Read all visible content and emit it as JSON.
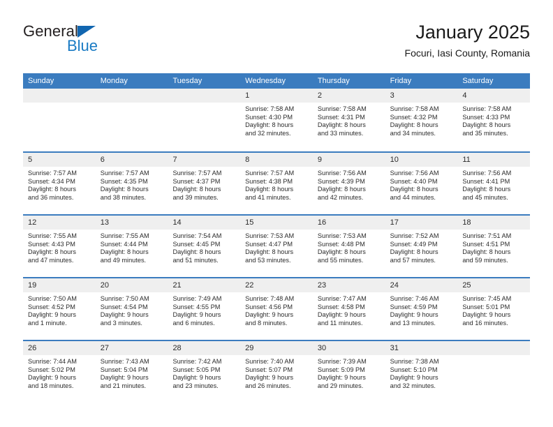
{
  "brand": {
    "line1": "General",
    "line2": "Blue",
    "triangle_color": "#1166b0",
    "blue_text_color": "#1a7bc4"
  },
  "header": {
    "title": "January 2025",
    "subtitle": "Focuri, Iasi County, Romania"
  },
  "theme": {
    "header_blue": "#3b7cbf",
    "daynum_band": "#efefef",
    "cell_bg": "#ffffff",
    "text": "#2b2b2b"
  },
  "weekdays": [
    "Sunday",
    "Monday",
    "Tuesday",
    "Wednesday",
    "Thursday",
    "Friday",
    "Saturday"
  ],
  "weeks": [
    [
      {
        "day": "",
        "sunrise": "",
        "sunset": "",
        "daylight_line1": "",
        "daylight_line2": ""
      },
      {
        "day": "",
        "sunrise": "",
        "sunset": "",
        "daylight_line1": "",
        "daylight_line2": ""
      },
      {
        "day": "",
        "sunrise": "",
        "sunset": "",
        "daylight_line1": "",
        "daylight_line2": ""
      },
      {
        "day": "1",
        "sunrise": "Sunrise: 7:58 AM",
        "sunset": "Sunset: 4:30 PM",
        "daylight_line1": "Daylight: 8 hours",
        "daylight_line2": "and 32 minutes."
      },
      {
        "day": "2",
        "sunrise": "Sunrise: 7:58 AM",
        "sunset": "Sunset: 4:31 PM",
        "daylight_line1": "Daylight: 8 hours",
        "daylight_line2": "and 33 minutes."
      },
      {
        "day": "3",
        "sunrise": "Sunrise: 7:58 AM",
        "sunset": "Sunset: 4:32 PM",
        "daylight_line1": "Daylight: 8 hours",
        "daylight_line2": "and 34 minutes."
      },
      {
        "day": "4",
        "sunrise": "Sunrise: 7:58 AM",
        "sunset": "Sunset: 4:33 PM",
        "daylight_line1": "Daylight: 8 hours",
        "daylight_line2": "and 35 minutes."
      }
    ],
    [
      {
        "day": "5",
        "sunrise": "Sunrise: 7:57 AM",
        "sunset": "Sunset: 4:34 PM",
        "daylight_line1": "Daylight: 8 hours",
        "daylight_line2": "and 36 minutes."
      },
      {
        "day": "6",
        "sunrise": "Sunrise: 7:57 AM",
        "sunset": "Sunset: 4:35 PM",
        "daylight_line1": "Daylight: 8 hours",
        "daylight_line2": "and 38 minutes."
      },
      {
        "day": "7",
        "sunrise": "Sunrise: 7:57 AM",
        "sunset": "Sunset: 4:37 PM",
        "daylight_line1": "Daylight: 8 hours",
        "daylight_line2": "and 39 minutes."
      },
      {
        "day": "8",
        "sunrise": "Sunrise: 7:57 AM",
        "sunset": "Sunset: 4:38 PM",
        "daylight_line1": "Daylight: 8 hours",
        "daylight_line2": "and 41 minutes."
      },
      {
        "day": "9",
        "sunrise": "Sunrise: 7:56 AM",
        "sunset": "Sunset: 4:39 PM",
        "daylight_line1": "Daylight: 8 hours",
        "daylight_line2": "and 42 minutes."
      },
      {
        "day": "10",
        "sunrise": "Sunrise: 7:56 AM",
        "sunset": "Sunset: 4:40 PM",
        "daylight_line1": "Daylight: 8 hours",
        "daylight_line2": "and 44 minutes."
      },
      {
        "day": "11",
        "sunrise": "Sunrise: 7:56 AM",
        "sunset": "Sunset: 4:41 PM",
        "daylight_line1": "Daylight: 8 hours",
        "daylight_line2": "and 45 minutes."
      }
    ],
    [
      {
        "day": "12",
        "sunrise": "Sunrise: 7:55 AM",
        "sunset": "Sunset: 4:43 PM",
        "daylight_line1": "Daylight: 8 hours",
        "daylight_line2": "and 47 minutes."
      },
      {
        "day": "13",
        "sunrise": "Sunrise: 7:55 AM",
        "sunset": "Sunset: 4:44 PM",
        "daylight_line1": "Daylight: 8 hours",
        "daylight_line2": "and 49 minutes."
      },
      {
        "day": "14",
        "sunrise": "Sunrise: 7:54 AM",
        "sunset": "Sunset: 4:45 PM",
        "daylight_line1": "Daylight: 8 hours",
        "daylight_line2": "and 51 minutes."
      },
      {
        "day": "15",
        "sunrise": "Sunrise: 7:53 AM",
        "sunset": "Sunset: 4:47 PM",
        "daylight_line1": "Daylight: 8 hours",
        "daylight_line2": "and 53 minutes."
      },
      {
        "day": "16",
        "sunrise": "Sunrise: 7:53 AM",
        "sunset": "Sunset: 4:48 PM",
        "daylight_line1": "Daylight: 8 hours",
        "daylight_line2": "and 55 minutes."
      },
      {
        "day": "17",
        "sunrise": "Sunrise: 7:52 AM",
        "sunset": "Sunset: 4:49 PM",
        "daylight_line1": "Daylight: 8 hours",
        "daylight_line2": "and 57 minutes."
      },
      {
        "day": "18",
        "sunrise": "Sunrise: 7:51 AM",
        "sunset": "Sunset: 4:51 PM",
        "daylight_line1": "Daylight: 8 hours",
        "daylight_line2": "and 59 minutes."
      }
    ],
    [
      {
        "day": "19",
        "sunrise": "Sunrise: 7:50 AM",
        "sunset": "Sunset: 4:52 PM",
        "daylight_line1": "Daylight: 9 hours",
        "daylight_line2": "and 1 minute."
      },
      {
        "day": "20",
        "sunrise": "Sunrise: 7:50 AM",
        "sunset": "Sunset: 4:54 PM",
        "daylight_line1": "Daylight: 9 hours",
        "daylight_line2": "and 3 minutes."
      },
      {
        "day": "21",
        "sunrise": "Sunrise: 7:49 AM",
        "sunset": "Sunset: 4:55 PM",
        "daylight_line1": "Daylight: 9 hours",
        "daylight_line2": "and 6 minutes."
      },
      {
        "day": "22",
        "sunrise": "Sunrise: 7:48 AM",
        "sunset": "Sunset: 4:56 PM",
        "daylight_line1": "Daylight: 9 hours",
        "daylight_line2": "and 8 minutes."
      },
      {
        "day": "23",
        "sunrise": "Sunrise: 7:47 AM",
        "sunset": "Sunset: 4:58 PM",
        "daylight_line1": "Daylight: 9 hours",
        "daylight_line2": "and 11 minutes."
      },
      {
        "day": "24",
        "sunrise": "Sunrise: 7:46 AM",
        "sunset": "Sunset: 4:59 PM",
        "daylight_line1": "Daylight: 9 hours",
        "daylight_line2": "and 13 minutes."
      },
      {
        "day": "25",
        "sunrise": "Sunrise: 7:45 AM",
        "sunset": "Sunset: 5:01 PM",
        "daylight_line1": "Daylight: 9 hours",
        "daylight_line2": "and 16 minutes."
      }
    ],
    [
      {
        "day": "26",
        "sunrise": "Sunrise: 7:44 AM",
        "sunset": "Sunset: 5:02 PM",
        "daylight_line1": "Daylight: 9 hours",
        "daylight_line2": "and 18 minutes."
      },
      {
        "day": "27",
        "sunrise": "Sunrise: 7:43 AM",
        "sunset": "Sunset: 5:04 PM",
        "daylight_line1": "Daylight: 9 hours",
        "daylight_line2": "and 21 minutes."
      },
      {
        "day": "28",
        "sunrise": "Sunrise: 7:42 AM",
        "sunset": "Sunset: 5:05 PM",
        "daylight_line1": "Daylight: 9 hours",
        "daylight_line2": "and 23 minutes."
      },
      {
        "day": "29",
        "sunrise": "Sunrise: 7:40 AM",
        "sunset": "Sunset: 5:07 PM",
        "daylight_line1": "Daylight: 9 hours",
        "daylight_line2": "and 26 minutes."
      },
      {
        "day": "30",
        "sunrise": "Sunrise: 7:39 AM",
        "sunset": "Sunset: 5:09 PM",
        "daylight_line1": "Daylight: 9 hours",
        "daylight_line2": "and 29 minutes."
      },
      {
        "day": "31",
        "sunrise": "Sunrise: 7:38 AM",
        "sunset": "Sunset: 5:10 PM",
        "daylight_line1": "Daylight: 9 hours",
        "daylight_line2": "and 32 minutes."
      },
      {
        "day": "",
        "sunrise": "",
        "sunset": "",
        "daylight_line1": "",
        "daylight_line2": ""
      }
    ]
  ]
}
